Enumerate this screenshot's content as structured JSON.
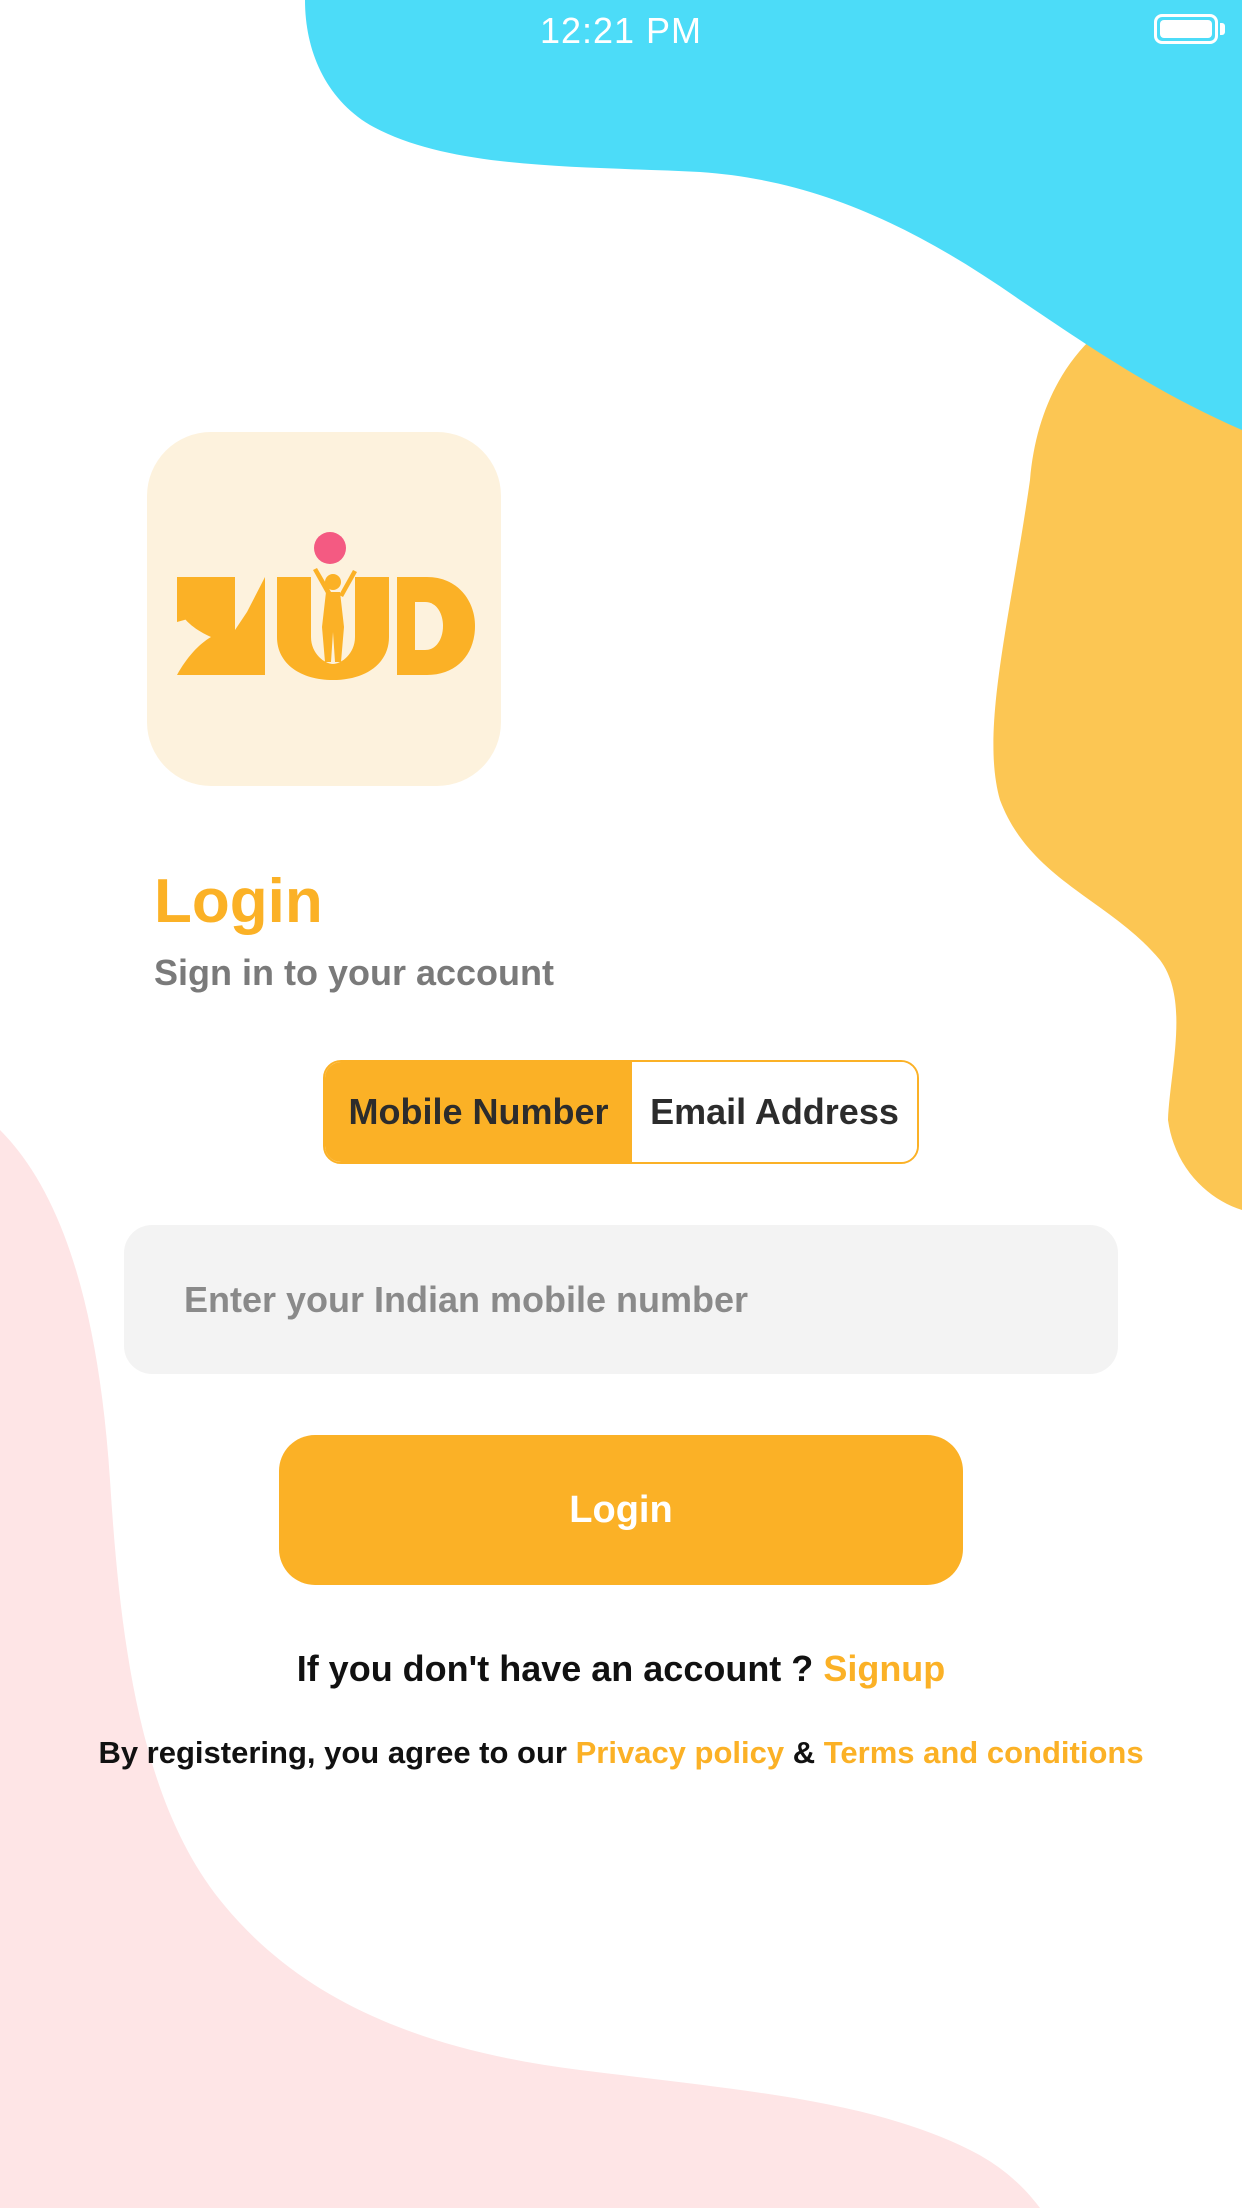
{
  "status_bar": {
    "time": "12:21 PM"
  },
  "logo": {
    "text": "KiD",
    "icon": "child-with-ball-logo"
  },
  "login": {
    "title": "Login",
    "subtitle": "Sign in to your account"
  },
  "tabs": [
    {
      "label": "Mobile Number",
      "selected": true
    },
    {
      "label": "Email Address",
      "selected": false
    }
  ],
  "input": {
    "placeholder": "Enter your Indian mobile number",
    "value": ""
  },
  "login_button": {
    "label": "Login"
  },
  "signup": {
    "prompt": "If you don't have an account ?",
    "link": "Signup"
  },
  "terms": {
    "prefix": "By registering, you agree to our",
    "privacy_link": "Privacy policy",
    "amp": "&",
    "terms_link": "Terms and conditions"
  },
  "colors": {
    "accent": "#fbb126",
    "cyan_blob": "#4cdcf8",
    "yellow_blob": "#fcc653",
    "pink_blob": "#fee5e6",
    "logo_bg": "#fdf2dd",
    "logo_dot": "#f45a82"
  }
}
